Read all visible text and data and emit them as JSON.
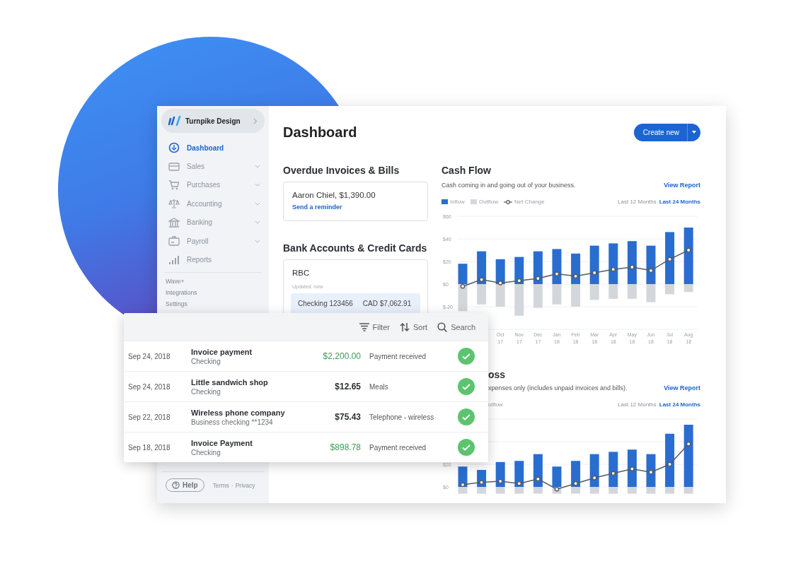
{
  "sidebar": {
    "company": "Turnpike Design",
    "nav": [
      {
        "label": "Dashboard",
        "selected": true,
        "expandable": false
      },
      {
        "label": "Sales",
        "selected": false,
        "expandable": true
      },
      {
        "label": "Purchases",
        "selected": false,
        "expandable": true
      },
      {
        "label": "Accounting",
        "selected": false,
        "expandable": true
      },
      {
        "label": "Banking",
        "selected": false,
        "expandable": true
      },
      {
        "label": "Payroll",
        "selected": false,
        "expandable": true
      },
      {
        "label": "Reports",
        "selected": false,
        "expandable": false
      }
    ],
    "secondary": [
      "Wave+",
      "Integrations",
      "Settings"
    ],
    "help": "Help",
    "footer_links": [
      "Terms",
      "Privacy"
    ],
    "footer_separator": "·"
  },
  "header": {
    "title": "Dashboard",
    "create_button": "Create new"
  },
  "overdue": {
    "title": "Overdue Invoices & Bills",
    "items": [
      {
        "text": "Aaron Chiel, $1,390.00",
        "link": "Send a reminder"
      }
    ]
  },
  "bank_accounts": {
    "title": "Bank Accounts & Credit Cards",
    "accounts": [
      {
        "bank": "RBC",
        "updated": "Updated: now",
        "rows": [
          {
            "name": "Checking 123456",
            "balance": "CAD $7,062.91"
          }
        ]
      }
    ]
  },
  "cash_flow": {
    "title": "Cash Flow",
    "subtitle": "Cash coming in and going out of your business.",
    "link": "View Report",
    "ranges": [
      {
        "label": "Last 12 Months",
        "selected": false
      },
      {
        "label": "Last 24 Months",
        "selected": true
      }
    ],
    "chart_data": {
      "type": "bar",
      "stacked": true,
      "grid": true,
      "categories": [
        null,
        null,
        "Oct 17",
        "Nov 17",
        "Dec 17",
        "Jan 18",
        "Feb 18",
        "Mar 18",
        "Apr 18",
        "May 18",
        "Jun 18",
        "Jul 18",
        "Aug 18"
      ],
      "ylim": [
        -40,
        60
      ],
      "yticks": [
        {
          "value": 60,
          "label": "$60"
        },
        {
          "value": 40,
          "label": "$40"
        },
        {
          "value": 20,
          "label": "$20"
        },
        {
          "value": 0,
          "label": "$0"
        },
        {
          "value": -20,
          "label": "$-20"
        }
      ],
      "series": [
        {
          "name": "Inflow",
          "type": "bar",
          "color": "#2a6dd0",
          "values": [
            18,
            29,
            22,
            24,
            29,
            31,
            27,
            34,
            36,
            38,
            34,
            46,
            50
          ]
        },
        {
          "name": "Outflow",
          "type": "bar",
          "color": "#d3d7dc",
          "values": [
            -24,
            -18,
            -20,
            -28,
            -21,
            -18,
            -20,
            -14,
            -13,
            -13,
            -16,
            -9,
            -7
          ]
        },
        {
          "name": "Net Change",
          "type": "line",
          "marker": true,
          "color": "#555a60",
          "values": [
            -2,
            4,
            1,
            3,
            5,
            9,
            7,
            10,
            13,
            15,
            12,
            22,
            30
          ]
        }
      ]
    }
  },
  "profit_loss": {
    "title": "oss",
    "subtitle": "xpenses only (includes unpaid invoices and bills).",
    "link": "View Report",
    "legend": [
      "utflow"
    ],
    "ranges": [
      {
        "label": "Last 12 Months",
        "selected": false
      },
      {
        "label": "Last 24 Months",
        "selected": true
      }
    ],
    "chart_data": {
      "type": "bar",
      "stacked": true,
      "grid": true,
      "ylim": [
        -7,
        60
      ],
      "yticks": [
        {
          "value": 20,
          "label": "$20"
        },
        {
          "value": 0,
          "label": "$0"
        }
      ],
      "series": [
        {
          "type": "bar",
          "color": "#2a6dd0",
          "values": [
            18,
            15,
            22,
            23,
            29,
            18,
            23,
            29,
            31,
            33,
            29,
            47,
            55
          ]
        },
        {
          "type": "bar",
          "color": "#d3d7dc",
          "values": [
            -6,
            -6,
            -6,
            -6,
            -6,
            -6,
            -6,
            -6,
            -6,
            -6,
            -6,
            -6,
            -6
          ]
        },
        {
          "type": "line",
          "marker": true,
          "color": "#555a60",
          "values": [
            2,
            4,
            5,
            3,
            7,
            -2,
            3,
            8,
            12,
            16,
            13,
            20,
            38
          ]
        }
      ]
    }
  },
  "transactions": {
    "tools": [
      "Filter",
      "Sort",
      "Search"
    ],
    "rows": [
      {
        "date": "Sep 24, 2018",
        "title": "Invoice payment",
        "account": "Checking",
        "amount": "$2,200.00",
        "incoming": true,
        "category": "Payment received",
        "reconciled": true
      },
      {
        "date": "Sep 24, 2018",
        "title": "Little sandwich shop",
        "account": "Checking",
        "amount": "$12.65",
        "incoming": false,
        "category": "Meals",
        "reconciled": true
      },
      {
        "date": "Sep 22, 2018",
        "title": "Wireless phone company",
        "account": "Business checking **1234",
        "amount": "$75.43",
        "incoming": false,
        "category": "Telephone - wireless",
        "reconciled": true
      },
      {
        "date": "Sep 18, 2018",
        "title": "Invoice Payment",
        "account": "Checking",
        "amount": "$898.78",
        "incoming": true,
        "category": "Payment received",
        "reconciled": true
      }
    ]
  }
}
